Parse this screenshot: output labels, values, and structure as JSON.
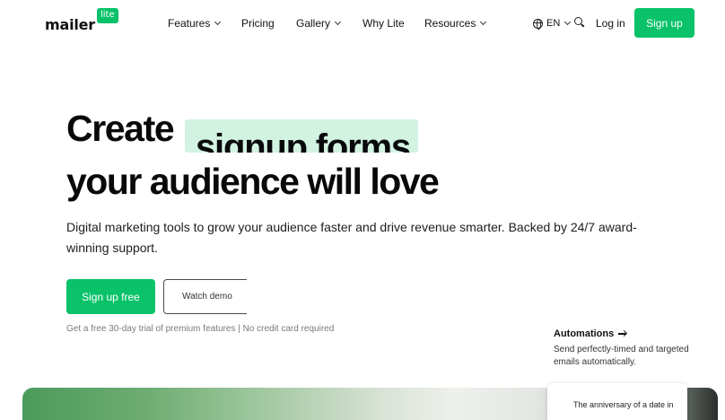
{
  "header": {
    "logo_word": "mailer",
    "logo_badge": "lite",
    "nav": [
      {
        "label": "Features",
        "dropdown": true
      },
      {
        "label": "Pricing",
        "dropdown": false
      },
      {
        "label": "Gallery",
        "dropdown": true
      },
      {
        "label": "Why Lite",
        "dropdown": false
      },
      {
        "label": "Resources",
        "dropdown": true
      }
    ],
    "language": "EN",
    "login_label": "Log in",
    "signup_label": "Sign up"
  },
  "hero": {
    "line1": "Create",
    "highlight": "signup forms",
    "line2": "your audience will love",
    "subtitle": "Digital marketing tools to grow your audience faster and drive revenue smarter. Backed by 24/7 award-winning support.",
    "primary_cta": "Sign up free",
    "secondary_cta": "Watch demo",
    "trial_note": "Get a free 30-day trial of premium features | No credit card required"
  },
  "automations": {
    "title": "Automations",
    "description": "Send perfectly-timed and targeted emails automatically."
  },
  "preview_card": {
    "text": "The anniversary of a date in"
  },
  "colors": {
    "brand_green": "#09c269",
    "highlight_bg": "#d2f3e2",
    "text_dark": "#09090b"
  },
  "icons": [
    "globe-icon",
    "chevron-down-icon",
    "search-icon",
    "arrow-right-icon"
  ]
}
